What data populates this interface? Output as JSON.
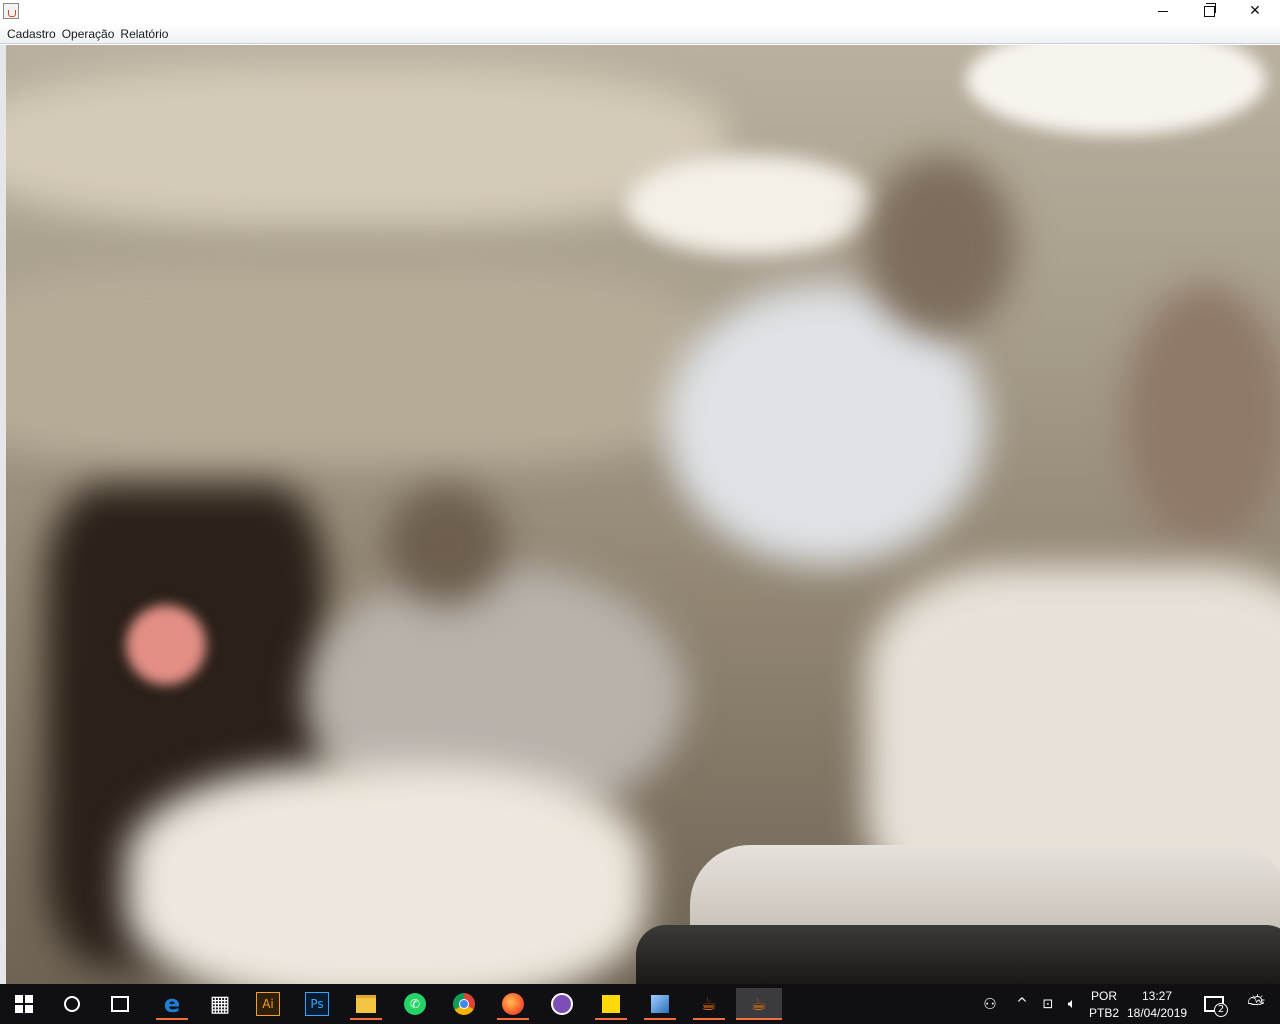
{
  "window": {
    "controls": {
      "minimize": "minimize-icon",
      "maximize": "restore-icon",
      "close": "close-icon"
    }
  },
  "menu": {
    "items": [
      {
        "label": "Cadastro"
      },
      {
        "label": "Operação"
      },
      {
        "label": "Relatório"
      }
    ]
  },
  "taskbar": {
    "apps": [
      {
        "name": "edge",
        "glyph": "e"
      },
      {
        "name": "calculator",
        "glyph": "▦"
      },
      {
        "name": "illustrator",
        "glyph": "Ai"
      },
      {
        "name": "photoshop",
        "glyph": "Ps"
      },
      {
        "name": "file-explorer",
        "glyph": "▬"
      },
      {
        "name": "whatsapp",
        "glyph": "✆"
      },
      {
        "name": "chrome",
        "glyph": "◉"
      },
      {
        "name": "firefox",
        "glyph": "◍"
      },
      {
        "name": "purple-app",
        "glyph": "◕"
      },
      {
        "name": "sticky-notes",
        "glyph": "■"
      },
      {
        "name": "virtualbox",
        "glyph": "◇"
      },
      {
        "name": "java",
        "glyph": "☕"
      },
      {
        "name": "java-active",
        "glyph": "☕"
      }
    ],
    "tray": {
      "lang_top": "POR",
      "lang_bottom": "PTB2",
      "time": "13:27",
      "date": "18/04/2019",
      "notifications": "2"
    }
  }
}
